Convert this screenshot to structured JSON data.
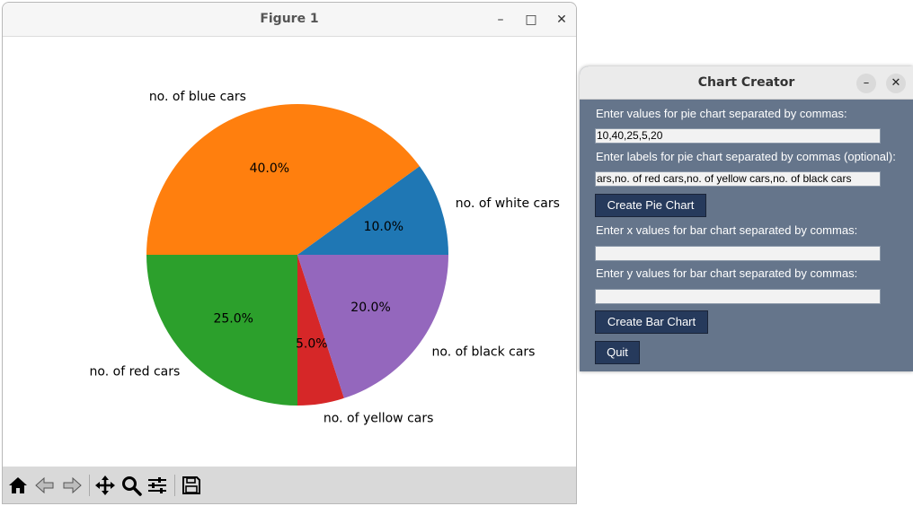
{
  "figure_window": {
    "title": "Figure 1",
    "controls": {
      "minimize": "–",
      "maximize": "□",
      "close": "✕"
    }
  },
  "chart_data": {
    "type": "pie",
    "values": [
      10,
      40,
      25,
      5,
      20
    ],
    "labels": [
      "no. of white cars",
      "no. of blue cars",
      "no. of red cars",
      "no. of yellow cars",
      "no. of black cars"
    ],
    "percent_labels": [
      "10.0%",
      "40.0%",
      "25.0%",
      "5.0%",
      "20.0%"
    ],
    "colors": [
      "#1f77b4",
      "#ff7f0e",
      "#2ca02c",
      "#d62728",
      "#9467bd"
    ],
    "start_angle_deg": 0,
    "direction": "counterclockwise"
  },
  "toolbar_icons": [
    "home-icon",
    "back-arrow-icon",
    "forward-arrow-icon",
    "pan-icon",
    "zoom-icon",
    "configure-subplots-icon",
    "save-icon"
  ],
  "chart_creator": {
    "title": "Chart Creator",
    "controls": {
      "minimize": "–",
      "close": "✕"
    },
    "pie_values_label": "Enter values for pie chart separated by commas:",
    "pie_values_value": "10,40,25,5,20",
    "pie_labels_label": "Enter labels for pie chart separated by commas (optional):",
    "pie_labels_value": "ars,no. of red cars,no. of yellow cars,no. of black cars",
    "create_pie_button": "Create Pie Chart",
    "bar_x_label": "Enter x values for bar chart separated by commas:",
    "bar_x_value": "",
    "bar_y_label": "Enter y values for bar chart separated by commas:",
    "bar_y_value": "",
    "create_bar_button": "Create Bar Chart",
    "quit_button": "Quit"
  }
}
